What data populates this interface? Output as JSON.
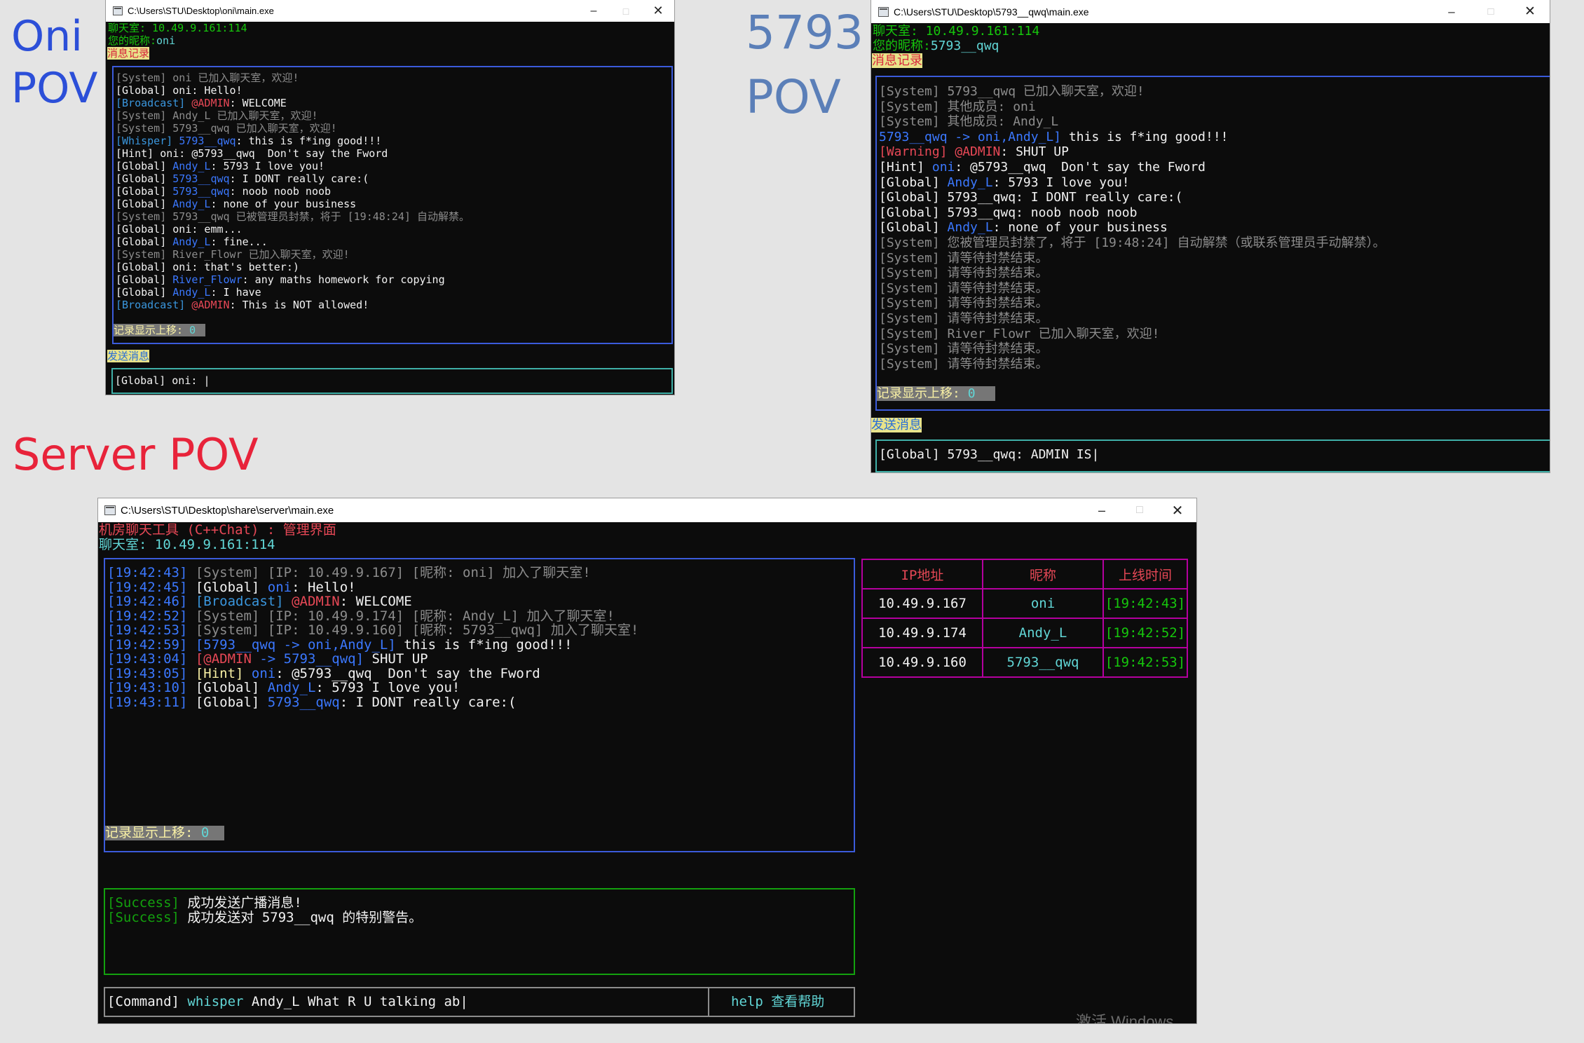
{
  "labels": {
    "oni_title": "Oni",
    "oni_sub": "POV",
    "q_title": "5793",
    "q_sub": "POV",
    "server": "Server POV"
  },
  "colors": {
    "label_blue": "#2c4fd8",
    "label_steel": "#5b7fb8",
    "label_red": "#e8233a"
  },
  "oni": {
    "window_title": "C:\\Users\\STU\\Desktop\\oni\\main.exe",
    "room": "聊天室: 10.49.9.161:114",
    "nick_label": "您的昵称:",
    "nick": "oni",
    "history_label": "消息记录",
    "messages": [
      [
        [
          "[System] oni 已加入聊天室，欢迎!",
          "gray"
        ]
      ],
      [
        [
          "[Global] oni: Hello!",
          "white"
        ]
      ],
      [
        [
          "[Broadcast] ",
          "cyan"
        ],
        [
          "@ADMIN",
          "red"
        ],
        [
          ": WELCOME",
          "white"
        ]
      ],
      [
        [
          "[System] Andy_L 已加入聊天室，欢迎!",
          "gray"
        ]
      ],
      [
        [
          "[System] 5793__qwq 已加入聊天室，欢迎!",
          "gray"
        ]
      ],
      [
        [
          "[Whisper] ",
          "cyan"
        ],
        [
          "5793__qwq",
          "blue"
        ],
        [
          ": this is f*ing good!!!",
          "white"
        ]
      ],
      [
        [
          "[Hint] oni: @5793__qwq  Don't say the Fword",
          "white"
        ]
      ],
      [
        [
          "[Global] ",
          "white"
        ],
        [
          "Andy_L",
          "blue"
        ],
        [
          ": 5793 I love you!",
          "white"
        ]
      ],
      [
        [
          "[Global] ",
          "white"
        ],
        [
          "5793__qwq",
          "blue"
        ],
        [
          ": I DONT really care:(",
          "white"
        ]
      ],
      [
        [
          "[Global] ",
          "white"
        ],
        [
          "5793__qwq",
          "blue"
        ],
        [
          ": noob noob noob",
          "white"
        ]
      ],
      [
        [
          "[Global] ",
          "white"
        ],
        [
          "Andy_L",
          "blue"
        ],
        [
          ": none of your business",
          "white"
        ]
      ],
      [
        [
          "[System] 5793__qwq 已被管理员封禁，将于 [19:48:24] 自动解禁。",
          "gray"
        ]
      ],
      [
        [
          "[Global] oni: emm...",
          "white"
        ]
      ],
      [
        [
          "[Global] ",
          "white"
        ],
        [
          "Andy_L",
          "blue"
        ],
        [
          ": fine...",
          "white"
        ]
      ],
      [
        [
          "[System] River_Flowr 已加入聊天室，欢迎!",
          "gray"
        ]
      ],
      [
        [
          "[Global] oni: that's better:)",
          "white"
        ]
      ],
      [
        [
          "[Global] ",
          "white"
        ],
        [
          "River_Flowr",
          "blue"
        ],
        [
          ": any maths homework for copying",
          "white"
        ]
      ],
      [
        [
          "[Global] ",
          "white"
        ],
        [
          "Andy_L",
          "blue"
        ],
        [
          ": I have",
          "white"
        ]
      ],
      [
        [
          "[Broadcast] ",
          "cyan"
        ],
        [
          "@ADMIN",
          "red"
        ],
        [
          ": This is NOT allowed!",
          "white"
        ]
      ]
    ],
    "scroll_label": "记录显示上移: ",
    "scroll_value": "0",
    "send_label": "发送消息",
    "input_prefix": "[Global] oni: "
  },
  "qwq": {
    "window_title": "C:\\Users\\STU\\Desktop\\5793__qwq\\main.exe",
    "room": "聊天室: 10.49.9.161:114",
    "nick_label": "您的昵称:",
    "nick": "5793__qwq",
    "history_label": "消息记录",
    "messages": [
      [
        [
          "[System] 5793__qwq 已加入聊天室，欢迎!",
          "gray"
        ]
      ],
      [
        [
          "[System] 其他成员: oni",
          "gray"
        ]
      ],
      [
        [
          "[System] 其他成员: Andy_L",
          "gray"
        ]
      ],
      [
        [
          "5793__qwq -> oni,Andy_L]",
          "blue"
        ],
        [
          " this is f*ing good!!!",
          "white"
        ]
      ],
      [
        [
          "[Warning] ",
          "red"
        ],
        [
          "@ADMIN",
          "red"
        ],
        [
          ": SHUT UP",
          "white"
        ]
      ],
      [
        [
          "[Hint] ",
          "white"
        ],
        [
          "oni",
          "blue"
        ],
        [
          ": @5793__qwq  Don't say the Fword",
          "white"
        ]
      ],
      [
        [
          "[Global] ",
          "white"
        ],
        [
          "Andy_L",
          "blue"
        ],
        [
          ": 5793 I love you!",
          "white"
        ]
      ],
      [
        [
          "[Global] 5793__qwq: I DONT really care:(",
          "white"
        ]
      ],
      [
        [
          "[Global] 5793__qwq: noob noob noob",
          "white"
        ]
      ],
      [
        [
          "[Global] ",
          "white"
        ],
        [
          "Andy_L",
          "blue"
        ],
        [
          ": none of your business",
          "white"
        ]
      ],
      [
        [
          "[System] 您被管理员封禁了，将于 [19:48:24] 自动解禁（或联系管理员手动解禁）。",
          "gray"
        ]
      ],
      [
        [
          "[System] 请等待封禁结束。",
          "gray"
        ]
      ],
      [
        [
          "[System] 请等待封禁结束。",
          "gray"
        ]
      ],
      [
        [
          "[System] 请等待封禁结束。",
          "gray"
        ]
      ],
      [
        [
          "[System] 请等待封禁结束。",
          "gray"
        ]
      ],
      [
        [
          "[System] 请等待封禁结束。",
          "gray"
        ]
      ],
      [
        [
          "[System] River_Flowr 已加入聊天室，欢迎!",
          "gray"
        ]
      ],
      [
        [
          "[System] 请等待封禁结束。",
          "gray"
        ]
      ],
      [
        [
          "[System] 请等待封禁结束。",
          "gray"
        ]
      ]
    ],
    "scroll_label": "记录显示上移: ",
    "scroll_value": "0",
    "send_label": "发送消息",
    "input_prefix": "[Global] 5793__qwq: ",
    "input_text": "ADMIN IS"
  },
  "server": {
    "window_title": "C:\\Users\\STU\\Desktop\\share\\server\\main.exe",
    "app_title": "机房聊天工具 (C++Chat) : 管理界面",
    "room": "聊天室: 10.49.9.161:114",
    "log": [
      [
        [
          "[19:42:43]",
          "blue"
        ],
        [
          " [System] [IP: 10.49.9.167] [昵称: oni] 加入了聊天室!",
          "gray"
        ]
      ],
      [
        [
          "[19:42:45]",
          "blue"
        ],
        [
          " [Global] ",
          "white"
        ],
        [
          "oni",
          "blue"
        ],
        [
          ": Hello!",
          "white"
        ]
      ],
      [
        [
          "[19:42:46]",
          "blue"
        ],
        [
          " [Broadcast] ",
          "cyan"
        ],
        [
          "@ADMIN",
          "red"
        ],
        [
          ": WELCOME",
          "white"
        ]
      ],
      [
        [
          "[19:42:52]",
          "blue"
        ],
        [
          " [System] [IP: 10.49.9.174] [昵称: Andy_L] 加入了聊天室!",
          "gray"
        ]
      ],
      [
        [
          "[19:42:53]",
          "blue"
        ],
        [
          " [System] [IP: 10.49.9.160] [昵称: 5793__qwq] 加入了聊天室!",
          "gray"
        ]
      ],
      [
        [
          "[19:42:59]",
          "blue"
        ],
        [
          " [5793__qwq -> oni,Andy_L]",
          "blue"
        ],
        [
          " this is f*ing good!!!",
          "white"
        ]
      ],
      [
        [
          "[19:43:04]",
          "blue"
        ],
        [
          " [@ADMIN",
          "red"
        ],
        [
          " -> 5793__qwq]",
          "blue"
        ],
        [
          " SHUT UP",
          "white"
        ]
      ],
      [
        [
          "[19:43:05]",
          "blue"
        ],
        [
          " [Hint] ",
          "lyellow"
        ],
        [
          "oni",
          "blue"
        ],
        [
          ": @5793__qwq  Don't say the Fword",
          "white"
        ]
      ],
      [
        [
          "[19:43:10]",
          "blue"
        ],
        [
          " [Global] ",
          "white"
        ],
        [
          "Andy_L",
          "blue"
        ],
        [
          ": 5793 I love you!",
          "white"
        ]
      ],
      [
        [
          "[19:43:11]",
          "blue"
        ],
        [
          " [Global] ",
          "white"
        ],
        [
          "5793__qwq",
          "blue"
        ],
        [
          ": I DONT really care:(",
          "white"
        ]
      ]
    ],
    "scroll_label": "记录显示上移: ",
    "scroll_value": "0",
    "table": {
      "headers": [
        "IP地址",
        "昵称",
        "上线时间"
      ],
      "rows": [
        [
          "10.49.9.167",
          "oni",
          "[19:42:43]"
        ],
        [
          "10.49.9.174",
          "Andy_L",
          "[19:42:52]"
        ],
        [
          "10.49.9.160",
          "5793__qwq",
          "[19:42:53]"
        ]
      ]
    },
    "status": [
      [
        [
          "[Success] ",
          "green"
        ],
        [
          "成功发送广播消息!",
          "white"
        ]
      ],
      [
        [
          "[Success] ",
          "green"
        ],
        [
          "成功发送对 5793__qwq 的特别警告。",
          "white"
        ]
      ]
    ],
    "cmd_prefix": "[Command] ",
    "cmd_verb": "whisper",
    "cmd_arg": " Andy_L What R U talking ab",
    "help": "help 查看帮助",
    "watermark": "激活 Windows"
  }
}
